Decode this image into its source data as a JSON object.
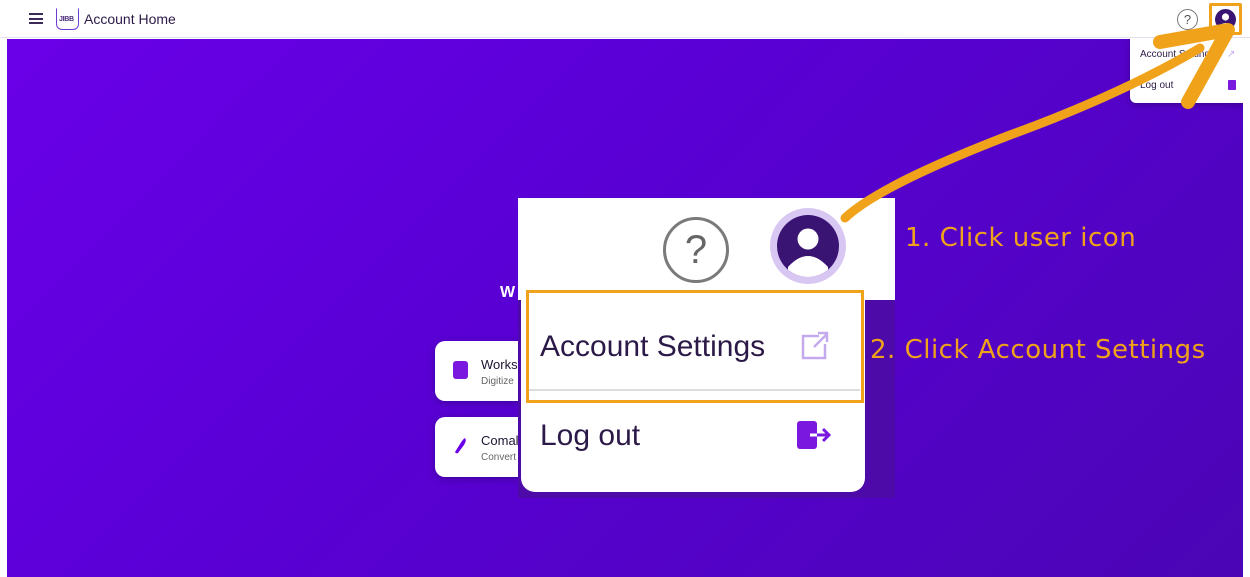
{
  "header": {
    "menu_icon": "hamburger-icon",
    "logo_text": "JIBB",
    "title": "Account Home",
    "help_icon": "question-mark-icon",
    "help_glyph": "?",
    "user_icon": "user-icon"
  },
  "user_menu": {
    "items": [
      {
        "label": "Account Settings",
        "icon": "external-link-icon"
      },
      {
        "label": "Log out",
        "icon": "logout-icon"
      }
    ]
  },
  "main": {
    "welcome_fragment": "W",
    "cards": [
      {
        "name": "Works",
        "description": "Digitize",
        "icon": "whiteboard-icon"
      },
      {
        "name": "Comal",
        "description": "Convert",
        "icon": "pen-icon"
      }
    ]
  },
  "zoom": {
    "help_glyph": "?",
    "account_settings": "Account Settings",
    "log_out": "Log out"
  },
  "annotations": {
    "step1": "1. Click user icon",
    "step2": "2. Click Account Settings"
  },
  "colors": {
    "brand_purple": "#6a00e8",
    "dark_purple": "#3a1472",
    "accent_orange": "#f0a21a",
    "logout_purple": "#7b18e0"
  }
}
